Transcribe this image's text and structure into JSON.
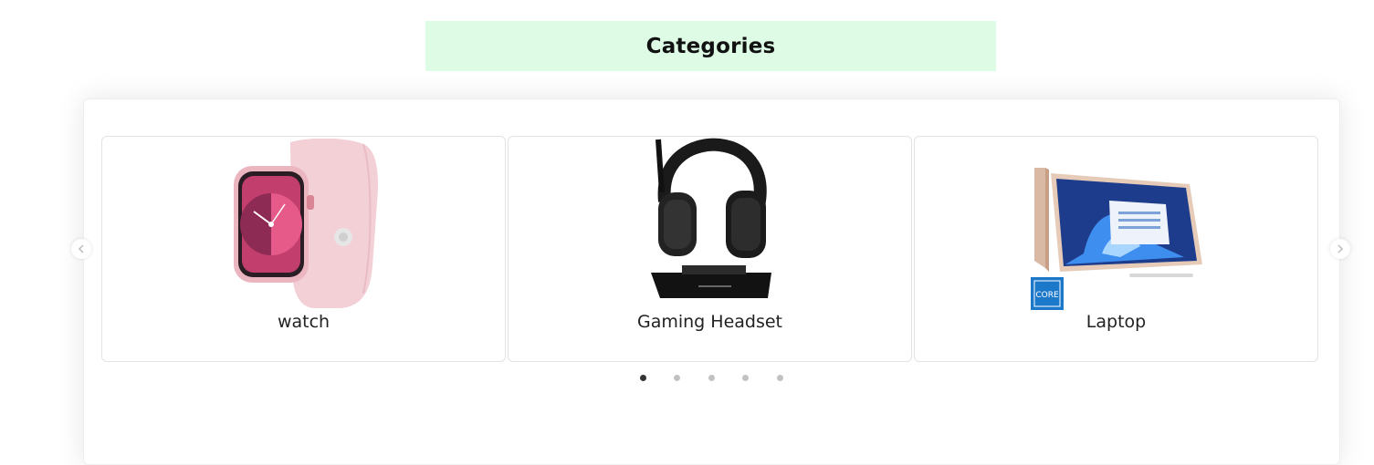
{
  "header": {
    "title": "Categories"
  },
  "carousel": {
    "items": [
      {
        "label": "watch",
        "icon": "smartwatch-image"
      },
      {
        "label": "Gaming Headset",
        "icon": "gaming-headset-image"
      },
      {
        "label": "Laptop",
        "icon": "laptop-image"
      }
    ],
    "dots": {
      "count": 5,
      "active_index": 0
    }
  },
  "colors": {
    "title_bg": "#ddfbe5",
    "dot_active": "#333333",
    "dot_inactive": "#c2c2c2"
  }
}
